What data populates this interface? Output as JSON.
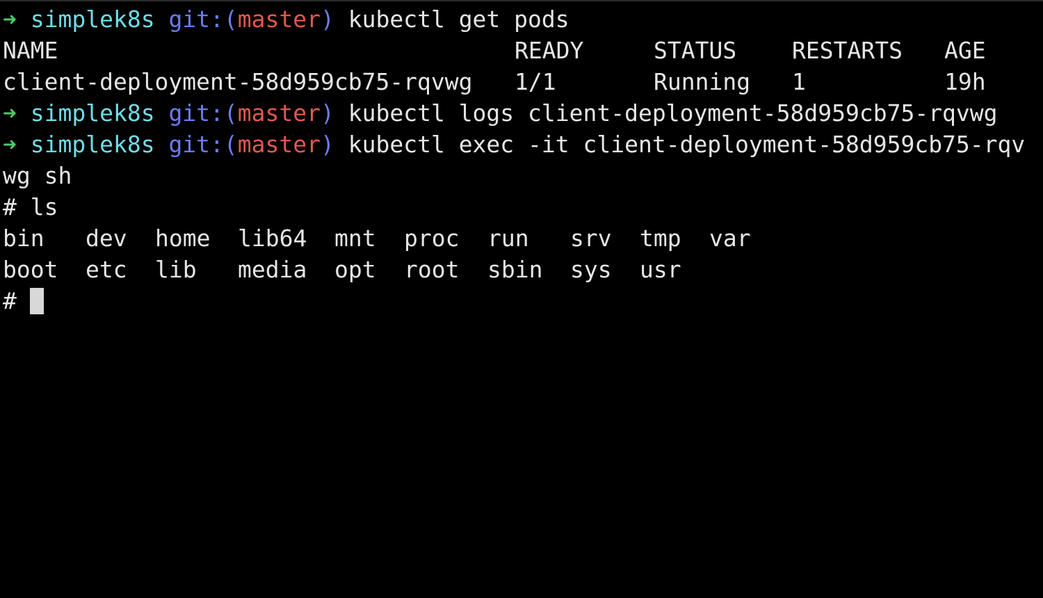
{
  "terminal": {
    "prompt": {
      "arrow": "➜",
      "dir": "simplek8s",
      "git_label": "git:(",
      "branch": "master",
      "git_close": ")"
    },
    "commands": {
      "get_pods": "kubectl get pods",
      "logs": "kubectl logs client-deployment-58d959cb75-rqvwg",
      "exec_line1": "kubectl exec -it client-deployment-58d959cb75-rqv",
      "exec_line2": "wg sh"
    },
    "pods_table": {
      "headers": [
        "NAME",
        "READY",
        "STATUS",
        "RESTARTS",
        "AGE"
      ],
      "rows": [
        [
          "client-deployment-58d959cb75-rqvwg",
          "1/1",
          "Running",
          "1",
          "19h"
        ]
      ]
    },
    "shell": {
      "ls_command": "# ls",
      "ls_rows": [
        [
          "bin",
          "dev",
          "home",
          "lib64",
          "mnt",
          "proc",
          "run",
          "srv",
          "tmp",
          "var"
        ],
        [
          "boot",
          "etc",
          "lib",
          "media",
          "opt",
          "root",
          "sbin",
          "sys",
          "usr"
        ]
      ],
      "final_prompt": "#"
    }
  }
}
